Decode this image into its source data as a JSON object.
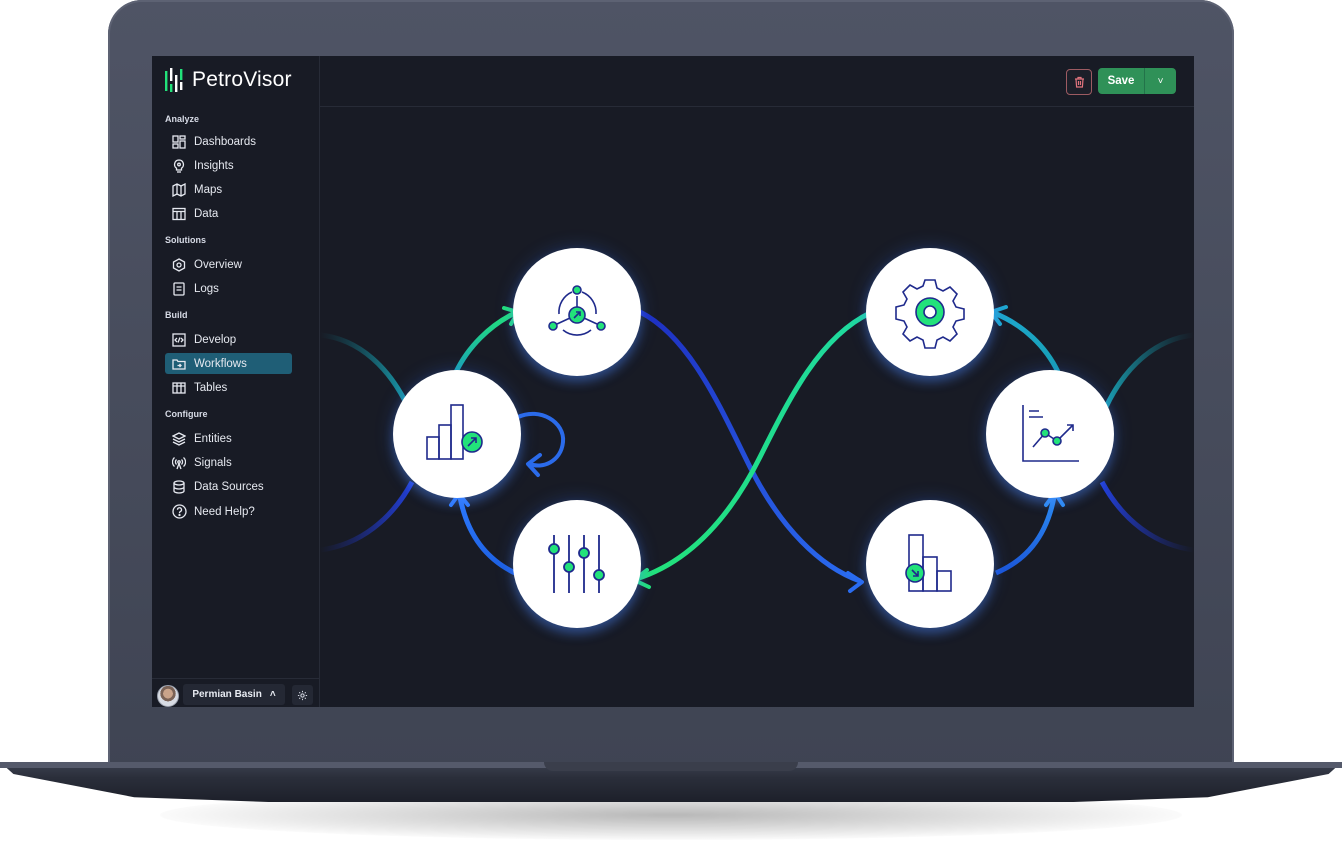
{
  "app": {
    "brand": "PetroVisor"
  },
  "sidebar": {
    "sections": [
      {
        "label": "Analyze",
        "items": [
          {
            "label": "Dashboards",
            "icon": "dashboard-icon"
          },
          {
            "label": "Insights",
            "icon": "lightbulb-icon"
          },
          {
            "label": "Maps",
            "icon": "map-icon"
          },
          {
            "label": "Data",
            "icon": "table-icon"
          }
        ]
      },
      {
        "label": "Solutions",
        "items": [
          {
            "label": "Overview",
            "icon": "hexagon-icon"
          },
          {
            "label": "Logs",
            "icon": "log-icon"
          }
        ]
      },
      {
        "label": "Build",
        "items": [
          {
            "label": "Develop",
            "icon": "code-icon"
          },
          {
            "label": "Workflows",
            "icon": "workflow-icon",
            "active": true
          },
          {
            "label": "Tables",
            "icon": "columns-icon"
          }
        ]
      },
      {
        "label": "Configure",
        "items": [
          {
            "label": "Entities",
            "icon": "layers-icon"
          },
          {
            "label": "Signals",
            "icon": "antenna-icon"
          },
          {
            "label": "Data Sources",
            "icon": "database-icon"
          },
          {
            "label": "Need Help?",
            "icon": "help-icon"
          }
        ]
      }
    ],
    "footer": {
      "workspace": "Permian Basin",
      "chevron": "˄"
    }
  },
  "toolbar": {
    "save_label": "Save",
    "dropdown_icon": "˅"
  },
  "colors": {
    "accent_green": "#22e27a",
    "accent_blue": "#1e40d6",
    "active_nav": "#1f5e76",
    "save_green": "#2f9158"
  }
}
